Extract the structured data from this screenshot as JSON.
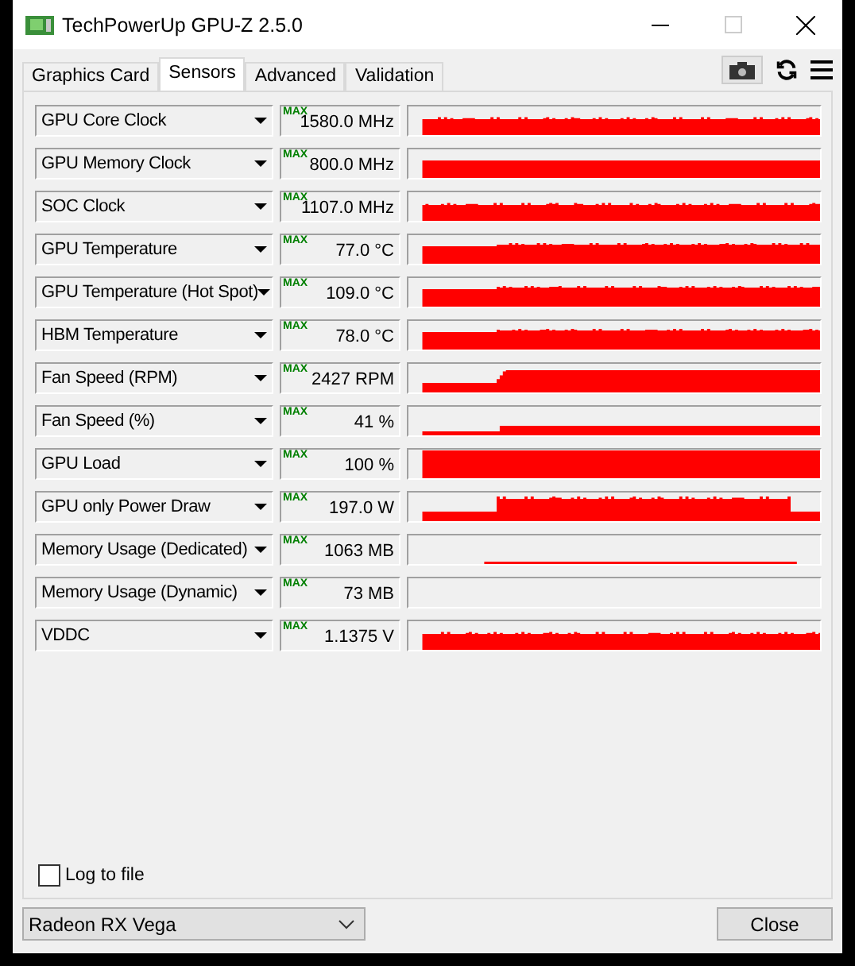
{
  "window": {
    "title": "TechPowerUp GPU-Z 2.5.0"
  },
  "tabs": [
    {
      "label": "Graphics Card",
      "selected": false
    },
    {
      "label": "Sensors",
      "selected": true
    },
    {
      "label": "Advanced",
      "selected": false
    },
    {
      "label": "Validation",
      "selected": false
    }
  ],
  "sensors": [
    {
      "name": "GPU Core Clock",
      "max_label": "MAX",
      "value": "1580.0 MHz",
      "kind": "steady"
    },
    {
      "name": "GPU Memory Clock",
      "max_label": "MAX",
      "value": "800.0 MHz",
      "kind": "flat"
    },
    {
      "name": "SOC Clock",
      "max_label": "MAX",
      "value": "1107.0 MHz",
      "kind": "steady"
    },
    {
      "name": "GPU Temperature",
      "max_label": "MAX",
      "value": "77.0 °C",
      "kind": "step"
    },
    {
      "name": "GPU Temperature (Hot Spot)",
      "max_label": "MAX",
      "value": "109.0 °C",
      "kind": "step"
    },
    {
      "name": "HBM Temperature",
      "max_label": "MAX",
      "value": "78.0 °C",
      "kind": "step"
    },
    {
      "name": "Fan Speed (RPM)",
      "max_label": "MAX",
      "value": "2427 RPM",
      "kind": "ramp"
    },
    {
      "name": "Fan Speed (%)",
      "max_label": "MAX",
      "value": "41 %",
      "kind": "lowramp"
    },
    {
      "name": "GPU Load",
      "max_label": "MAX",
      "value": "100 %",
      "kind": "full"
    },
    {
      "name": "GPU only Power Draw",
      "max_label": "MAX",
      "value": "197.0 W",
      "kind": "burst"
    },
    {
      "name": "Memory Usage (Dedicated)",
      "max_label": "MAX",
      "value": "1063 MB",
      "kind": "thin"
    },
    {
      "name": "Memory Usage (Dynamic)",
      "max_label": "MAX",
      "value": "73 MB",
      "kind": "none"
    },
    {
      "name": "VDDC",
      "max_label": "MAX",
      "value": "1.1375 V",
      "kind": "steady"
    }
  ],
  "log_to_file": {
    "label": "Log to file",
    "checked": false
  },
  "gpu_select": {
    "value": "Radeon RX Vega"
  },
  "close_button": {
    "label": "Close"
  }
}
